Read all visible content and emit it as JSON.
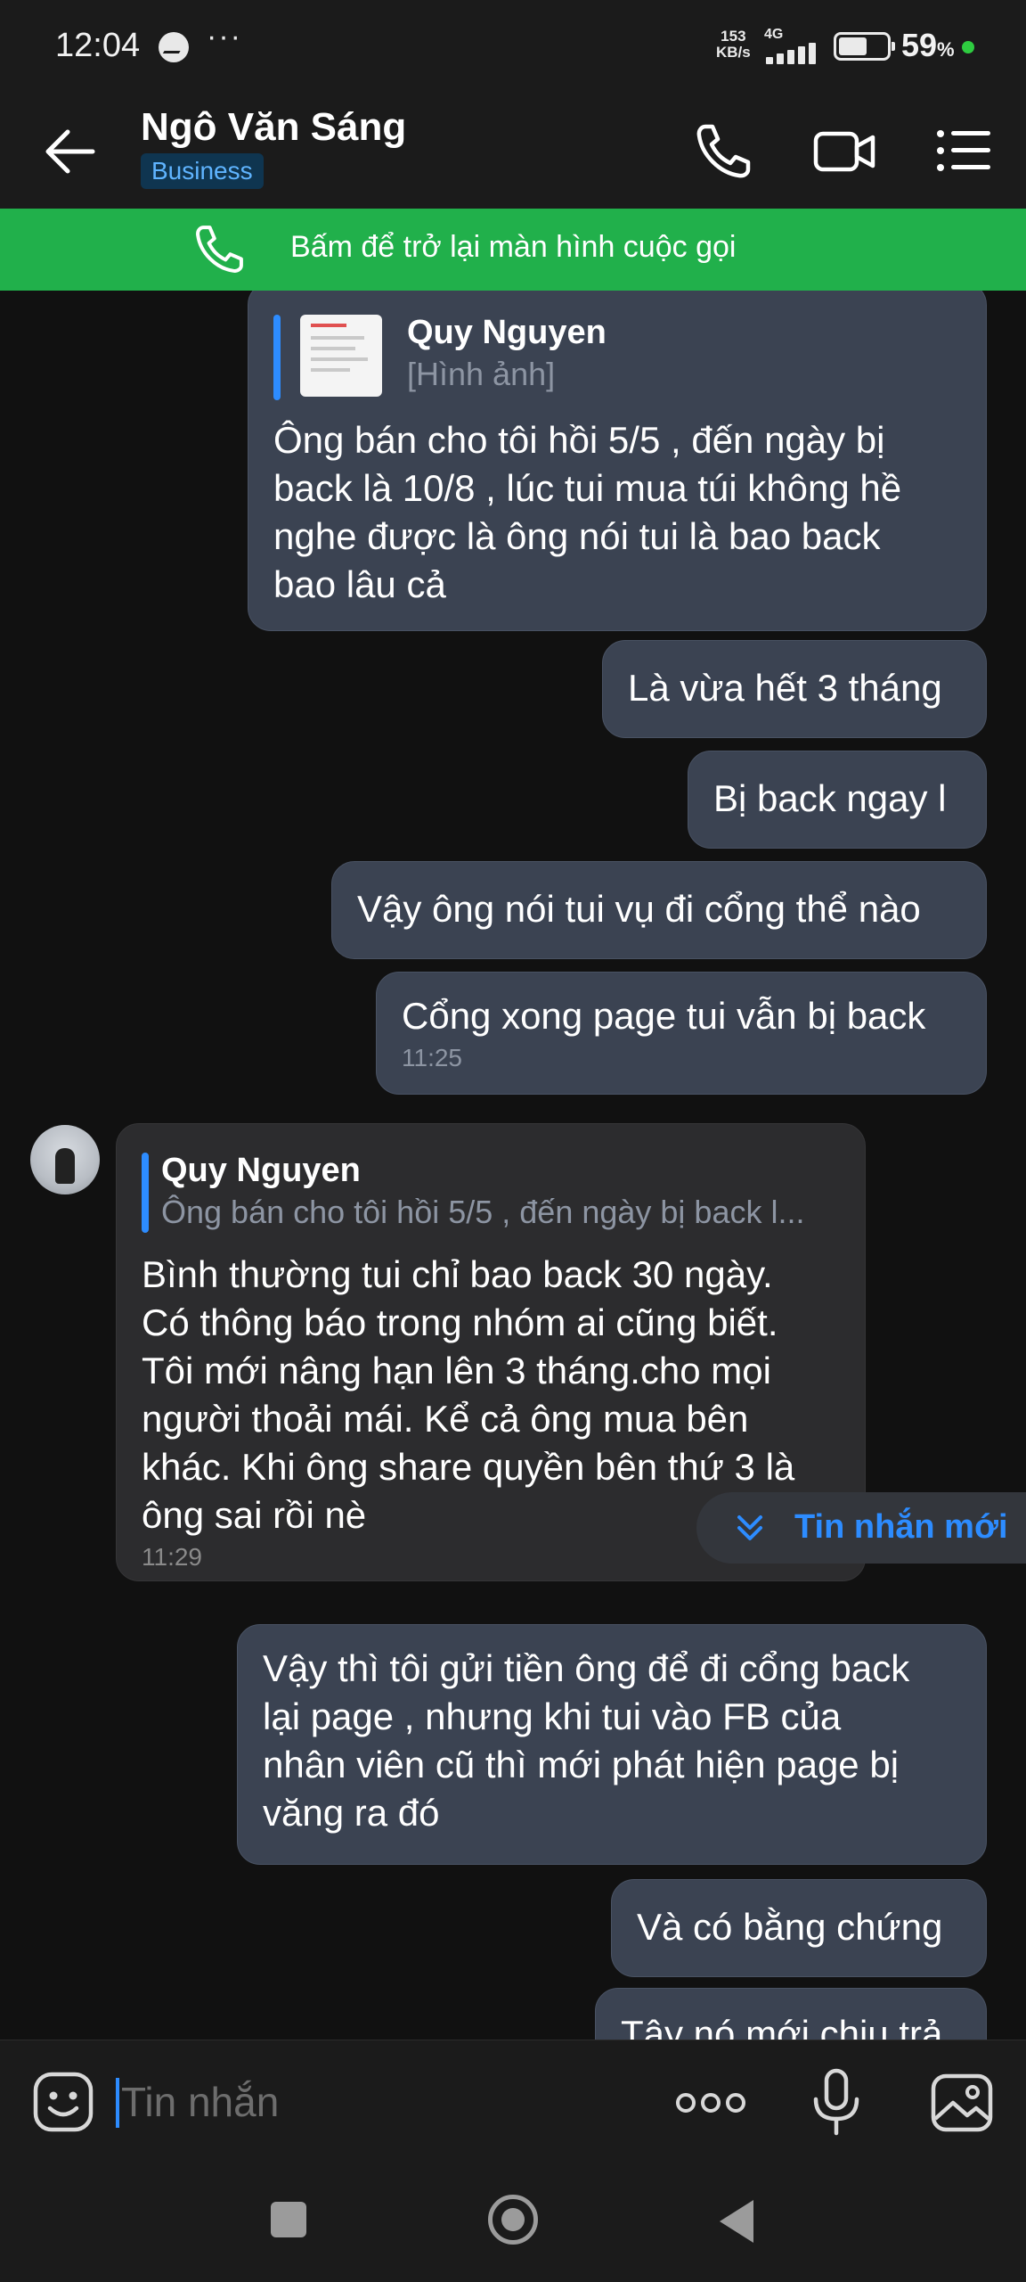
{
  "status_bar": {
    "time": "12:04",
    "dots": "···",
    "speed_value": "153",
    "speed_unit": "KB/s",
    "network": "4G",
    "battery_percent": "59",
    "percent_sign": "%",
    "battery_level": 0.59
  },
  "header": {
    "contact_name": "Ngô Văn Sáng",
    "badge": "Business"
  },
  "call_banner": {
    "text": "Bấm để trở lại màn hình cuộc gọi"
  },
  "messages": [
    {
      "quote_name": "Quy Nguyen",
      "quote_text": "[Hình ảnh]",
      "text_lines": [
        "Ông bán cho tôi hồi 5/5 , đến ngày bị",
        "back là 10/8 , lúc tui mua túi không hề",
        "nghe được là ông nói tui là bao back",
        "bao lâu cả"
      ]
    },
    {
      "text": "Là vừa hết 3 tháng"
    },
    {
      "text": "Bị back ngay l"
    },
    {
      "text": "Vậy ông nói tui vụ đi cổng thể nào"
    },
    {
      "text": "Cổng xong page tui vẫn bị back",
      "time": "11:25"
    },
    {
      "quote_name": "Quy Nguyen",
      "quote_text": "Ông bán cho tôi hồi 5/5 , đến ngày bị back l...",
      "text_lines": [
        "Bình thường tui chỉ bao back 30 ngày.",
        "Có thông báo trong nhóm ai cũng biết.",
        "Tôi mới nâng hạn lên 3 tháng.cho mọi",
        "người thoải mái. Kể cả ông mua bên",
        "khác. Khi ông share quyền bên thứ 3 là",
        "ông sai rồi nè"
      ],
      "time": "11:29"
    },
    {
      "text_lines": [
        "Vậy thì tôi gửi tiền ông để đi cổng back",
        "lại page , nhưng khi tui vào FB của",
        "nhân viên cũ thì mới phát hiện page bị",
        "văng ra đó"
      ]
    },
    {
      "text": "Và có bằng chứng"
    },
    {
      "text": "Tây nó mới chịu trả"
    }
  ],
  "new_messages_pill": {
    "label": "Tin nhắn mới"
  },
  "input": {
    "placeholder": "Tin nhắn"
  },
  "colors": {
    "accent": "#2d8cff",
    "banner": "#21b04b",
    "outgoing_bubble": "#3b4352",
    "incoming_bubble": "#2c2c2e"
  }
}
